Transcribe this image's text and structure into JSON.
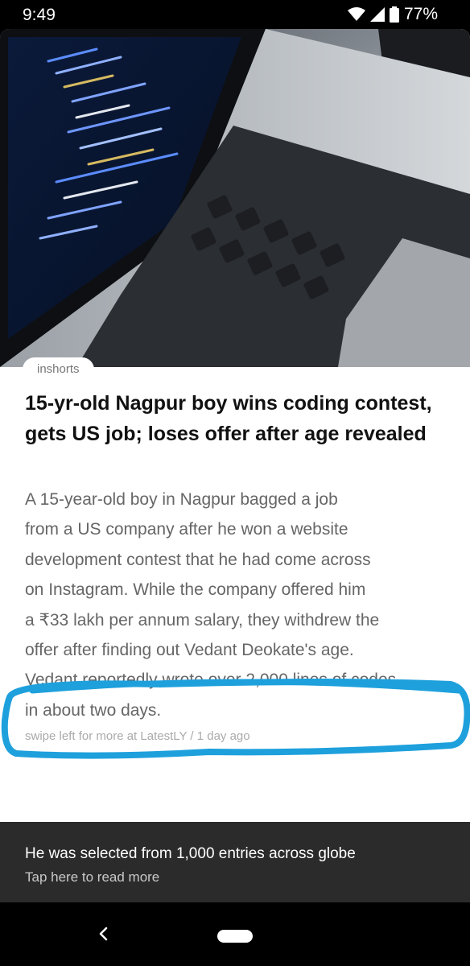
{
  "status_bar": {
    "time": "9:49",
    "battery": "77%",
    "icons": [
      "wifi-icon",
      "signal-icon",
      "battery-icon"
    ]
  },
  "article": {
    "source": "inshorts",
    "headline": "15-yr-old Nagpur boy wins coding contest, gets US job; loses offer after age revealed",
    "body": [
      "A 15-year-old boy in Nagpur bagged a job",
      "from a US company after he won a website",
      "development contest that he had come across",
      "on Instagram. While the company offered him",
      "a ₹33 lakh per annum salary, they withdrew the",
      "offer after finding out Vedant Deokate's age.",
      "Vedant reportedly wrote over 2,000 lines of codes",
      "in about two days."
    ],
    "meta": "swipe left for more at LatestLY / 1 day ago",
    "highlight_color": "#1ea0dc"
  },
  "footer": {
    "title": "He was selected from 1,000 entries across globe",
    "subtitle": "Tap here to read more"
  },
  "nav": {
    "icons": [
      "back-icon",
      "home-pill-icon"
    ]
  }
}
